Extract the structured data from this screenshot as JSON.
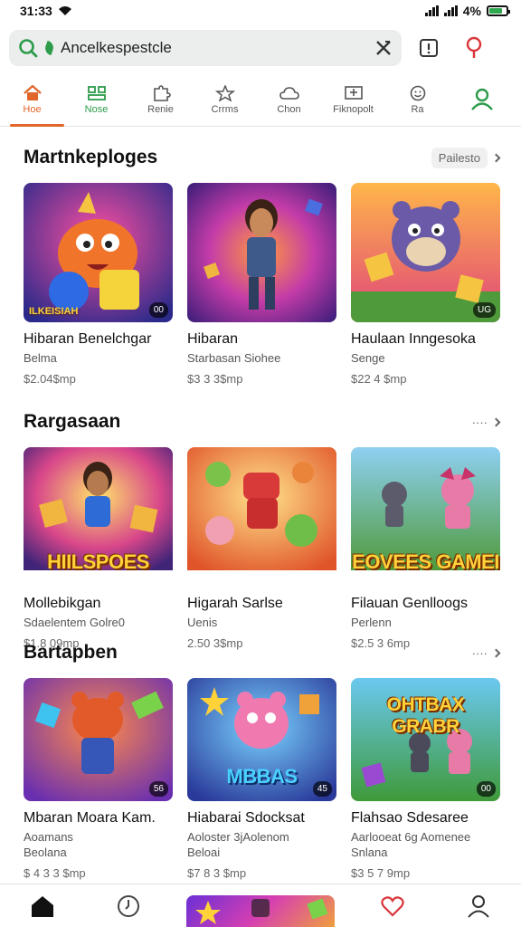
{
  "status_bar": {
    "time": "31:33",
    "battery_text": "4%",
    "battery_level": 0.8
  },
  "search": {
    "value": "Ancelkespestcle",
    "placeholder": "Ancelkespestcle"
  },
  "tabs": [
    {
      "label": "Hoe",
      "icon": "home-icon",
      "active": true
    },
    {
      "label": "Nose",
      "icon": "grid-icon",
      "active": false
    },
    {
      "label": "Renie",
      "icon": "puzzle-icon",
      "active": false
    },
    {
      "label": "Crrms",
      "icon": "star-icon",
      "active": false
    },
    {
      "label": "Chon",
      "icon": "cloud-icon",
      "active": false
    },
    {
      "label": "Fiknopolt",
      "icon": "board-icon",
      "active": false
    },
    {
      "label": "Ra",
      "icon": "smile-icon",
      "active": false
    },
    {
      "label": "",
      "icon": "profile-icon",
      "active": false
    }
  ],
  "sections": [
    {
      "title": "Martnkeploges",
      "see_all": "Pailesto",
      "cards": [
        {
          "title": "Hibaran Benelchgar",
          "subtitle": "Belma",
          "subtitle2": "",
          "price": "$2.04$mp",
          "badge": "00",
          "caption": "ILKEISIAH",
          "logo": ""
        },
        {
          "title": "Hibaran",
          "subtitle": "Starbasan Siohee",
          "subtitle2": "",
          "price": "$3 3 3$mp",
          "badge": "",
          "caption": "",
          "logo": ""
        },
        {
          "title": "Haulaan Inngesoka",
          "subtitle": "Senge",
          "subtitle2": "",
          "price": "$22 4 $mp",
          "badge": "UG",
          "caption": "",
          "logo": ""
        }
      ]
    },
    {
      "title": "Rargasaan",
      "see_all": "····",
      "cards": [
        {
          "title": "Mollebikgan",
          "subtitle": "Sdaelentem Golre0",
          "subtitle2": "",
          "price": "$1.8 09mp",
          "badge": "",
          "caption": "",
          "logo": "HIILSPOES"
        },
        {
          "title": "Higarah Sarlse",
          "subtitle": "Uenis",
          "subtitle2": "",
          "price": "2.50 3$mp",
          "badge": "",
          "caption": "",
          "logo": ""
        },
        {
          "title": "Filauan Genlloogs",
          "subtitle": "Perlenn",
          "subtitle2": "",
          "price": "$2.5 3 6mp",
          "badge": "",
          "caption": "",
          "logo": "EOVEES GAMEI"
        }
      ]
    },
    {
      "title": "Bartapben",
      "see_all": "····",
      "cards": [
        {
          "title": "Mbaran Moara Kam.",
          "subtitle": "Aoamans",
          "subtitle2": "Beolana",
          "price": "$ 4 3 3 $mp",
          "badge": "56",
          "caption": "",
          "logo": ""
        },
        {
          "title": "Hiabarai Sdocksat",
          "subtitle": "Aoloster 3jAolenom",
          "subtitle2": "Beloai",
          "price": "$7 8 3 $mp",
          "badge": "45",
          "caption": "",
          "logo": "MBBAS"
        },
        {
          "title": "Flahsao Sdesaree",
          "subtitle": "Aarlooeat 6g Aomenee",
          "subtitle2": "Snlana",
          "price": "$3 5 7 9mp",
          "badge": "00",
          "caption": "",
          "logo": "OHTBAX GRABR"
        }
      ]
    }
  ],
  "bottom_nav": [
    {
      "icon": "home-icon"
    },
    {
      "icon": "clock-icon"
    },
    {
      "icon": "featured-thumbnail"
    },
    {
      "icon": "heart-icon"
    },
    {
      "icon": "profile-icon"
    }
  ],
  "colors": {
    "accent": "#e0662b",
    "green": "#2c9b4a",
    "heart": "#d9353a"
  }
}
